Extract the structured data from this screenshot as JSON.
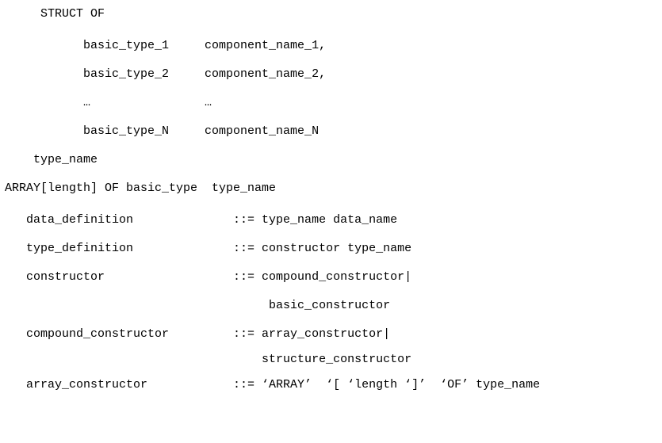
{
  "lines": {
    "struct_of": "     STRUCT OF",
    "struct_row1": "           basic_type_1     component_name_1,",
    "struct_row2": "           basic_type_2     component_name_2,",
    "struct_dots": "           …                …",
    "struct_rowN": "           basic_type_N     component_name_N",
    "struct_close": "    type_name",
    "array_of": "ARRAY[length] OF basic_type  type_name",
    "data_def": "   data_definition              ::= type_name data_name",
    "type_def": "   type_definition              ::= constructor type_name",
    "constructor": "   constructor                  ::= compound_constructor|",
    "basic_cons": "                                     basic_constructor",
    "comp_cons": "   compound_constructor         ::= array_constructor|",
    "struct_cons": "                                    structure_constructor",
    "array_cons": "   array_constructor            ::= ‘ARRAY’  ‘[ ‘length ‘]’  ‘OF’ type_name"
  }
}
